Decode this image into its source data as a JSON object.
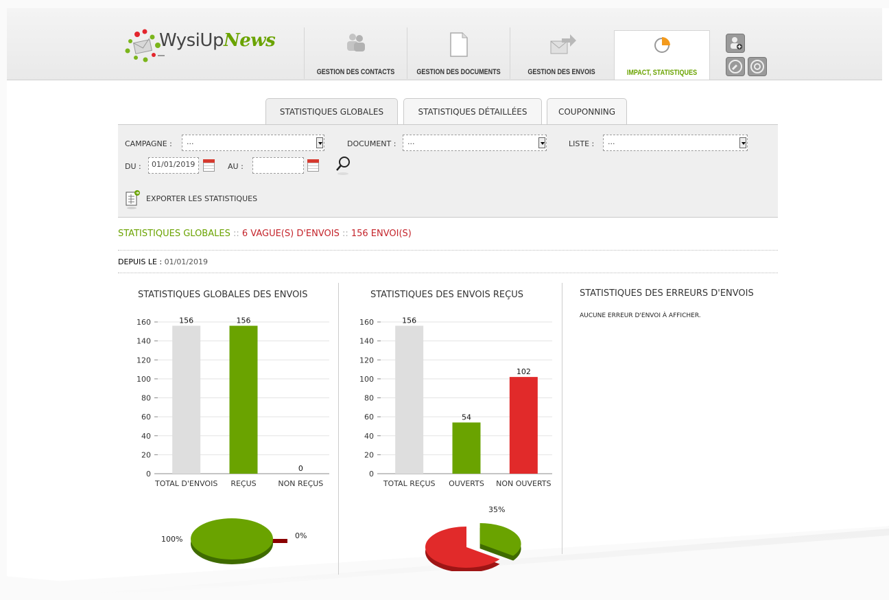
{
  "app": {
    "logo_main": "WysiUp",
    "logo_accent": "News"
  },
  "nav": {
    "tabs": [
      {
        "label": "GESTION DES CONTACTS",
        "icon": "contacts-icon"
      },
      {
        "label": "GESTION DES DOCUMENTS",
        "icon": "document-icon"
      },
      {
        "label": "GESTION DES ENVOIS",
        "icon": "send-envelope-icon"
      },
      {
        "label": "IMPACT, STATISTIQUES",
        "icon": "pie-chart-icon",
        "active": true
      }
    ],
    "tools": [
      "add-user-icon",
      "wrench-icon",
      "gear-icon"
    ]
  },
  "subtabs": [
    {
      "label": "STATISTIQUES GLOBALES",
      "active": true
    },
    {
      "label": "STATISTIQUES DÉTAILLÉES"
    },
    {
      "label": "COUPONNING"
    }
  ],
  "filters": {
    "campagne_label": "CAMPAGNE :",
    "campagne_value": "...",
    "document_label": "DOCUMENT :",
    "document_value": "...",
    "liste_label": "LISTE :",
    "liste_value": "...",
    "du_label": "DU :",
    "du_value": "01/01/2019",
    "au_label": "AU :",
    "au_value": ""
  },
  "export": {
    "label": "EXPORTER LES STATISTIQUES"
  },
  "summary": {
    "title": "STATISTIQUES GLOBALES",
    "sep": " :: ",
    "vagues": "6 VAGUE(S) D'ENVOIS",
    "envois": "156 ENVOI(S)",
    "depuis_label": "DEPUIS LE :",
    "depuis_value": "01/01/2019"
  },
  "colors": {
    "green": "#6aa300",
    "red": "#e12a2a",
    "grey": "#dedede",
    "darkred": "#8a0000"
  },
  "sections": {
    "envois_title": "STATISTIQUES GLOBALES DES ENVOIS",
    "recus_title": "STATISTIQUES DES ENVOIS REÇUS",
    "erreurs_title": "STATISTIQUES DES ERREURS D'ENVOIS",
    "erreurs_empty": "AUCUNE ERREUR D'ENVOI À AFFICHER."
  },
  "chart_data": [
    {
      "type": "bar",
      "title": "STATISTIQUES GLOBALES DES ENVOIS",
      "categories": [
        "TOTAL D'ENVOIS",
        "REÇUS",
        "NON REÇUS"
      ],
      "values": [
        156,
        156,
        0
      ],
      "bar_colors": [
        "#dedede",
        "#6aa300",
        "#e12a2a"
      ],
      "ylim": [
        0,
        160
      ],
      "yticks": [
        0,
        20,
        40,
        60,
        80,
        100,
        120,
        140,
        160
      ],
      "grid": true
    },
    {
      "type": "pie",
      "slices": [
        {
          "label": "100%",
          "value": 100,
          "color": "#6aa300"
        },
        {
          "label": "0%",
          "value": 0,
          "color": "#8a0000"
        }
      ]
    },
    {
      "type": "bar",
      "title": "STATISTIQUES DES ENVOIS REÇUS",
      "categories": [
        "TOTAL REÇUS",
        "OUVERTS",
        "NON OUVERTS"
      ],
      "values": [
        156,
        54,
        102
      ],
      "bar_colors": [
        "#dedede",
        "#6aa300",
        "#e12a2a"
      ],
      "ylim": [
        0,
        160
      ],
      "yticks": [
        0,
        20,
        40,
        60,
        80,
        100,
        120,
        140,
        160
      ],
      "grid": true
    },
    {
      "type": "pie",
      "slices": [
        {
          "label": "35%",
          "value": 35,
          "color": "#6aa300"
        },
        {
          "label": "",
          "value": 65,
          "color": "#e12a2a"
        }
      ]
    }
  ]
}
